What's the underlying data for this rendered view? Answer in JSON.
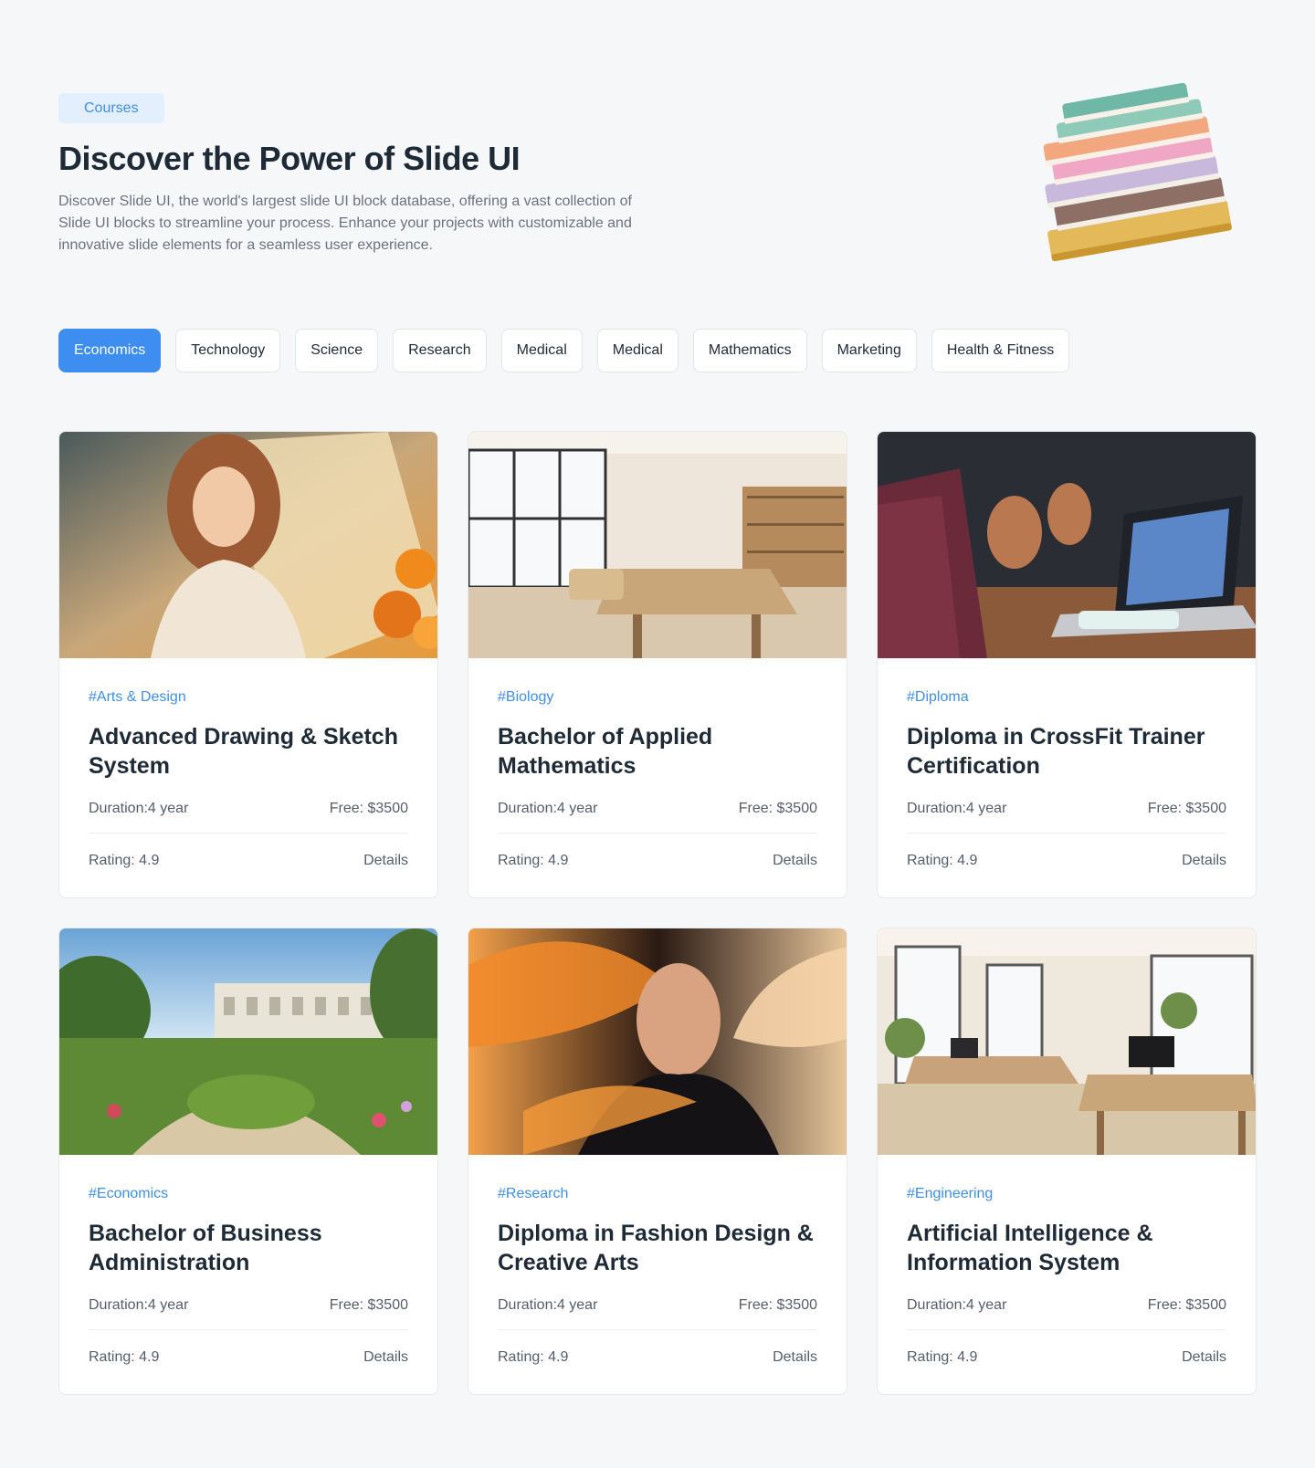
{
  "hero": {
    "badge": "Courses",
    "title": "Discover the Power of Slide UI",
    "description": "Discover Slide UI, the world's largest slide UI block database, offering a vast collection of Slide UI blocks to streamline your process. Enhance your projects with customizable and innovative slide elements for a seamless user experience."
  },
  "tabs": [
    {
      "label": "Economics",
      "active": true
    },
    {
      "label": "Technology",
      "active": false
    },
    {
      "label": "Science",
      "active": false
    },
    {
      "label": "Research",
      "active": false
    },
    {
      "label": "Medical",
      "active": false
    },
    {
      "label": "Medical",
      "active": false
    },
    {
      "label": "Mathematics",
      "active": false
    },
    {
      "label": "Marketing",
      "active": false
    },
    {
      "label": "Health & Fitness",
      "active": false
    }
  ],
  "cards": [
    {
      "tag": "#Arts & Design",
      "title": "Advanced Drawing & Sketch System",
      "duration": "Duration:4 year",
      "fee": "Free: $3500",
      "rating": "Rating: 4.9",
      "details": "Details",
      "image": "woman-painting-photo"
    },
    {
      "tag": "#Biology",
      "title": "Bachelor of Applied Mathematics",
      "duration": "Duration:4 year",
      "fee": "Free: $3500",
      "rating": "Rating: 4.9",
      "details": "Details",
      "image": "bright-office-photo"
    },
    {
      "tag": "#Diploma",
      "title": "Diploma in CrossFit  Trainer Certification",
      "duration": "Duration:4 year",
      "fee": "Free: $3500",
      "rating": "Rating: 4.9",
      "details": "Details",
      "image": "laptop-discussion-photo"
    },
    {
      "tag": "#Economics",
      "title": "Bachelor of Business Administration",
      "duration": "Duration:4 year",
      "fee": "Free: $3500",
      "rating": "Rating: 4.9",
      "details": "Details",
      "image": "campus-garden-photo"
    },
    {
      "tag": "#Research",
      "title": "Diploma in Fashion Design & Creative Arts",
      "duration": "Duration:4 year",
      "fee": "Free: $3500",
      "rating": "Rating: 4.9",
      "details": "Details",
      "image": "fashion-portrait-photo"
    },
    {
      "tag": "#Engineering",
      "title": "Artificial Intelligence & Information System",
      "duration": "Duration:4 year",
      "fee": "Free: $3500",
      "rating": "Rating: 4.9",
      "details": "Details",
      "image": "open-office-photo"
    }
  ],
  "colors": {
    "accent": "#3d8ef0",
    "tag": "#3f8fe6",
    "badge_bg": "#e3effc",
    "background": "#f6f7f9"
  }
}
